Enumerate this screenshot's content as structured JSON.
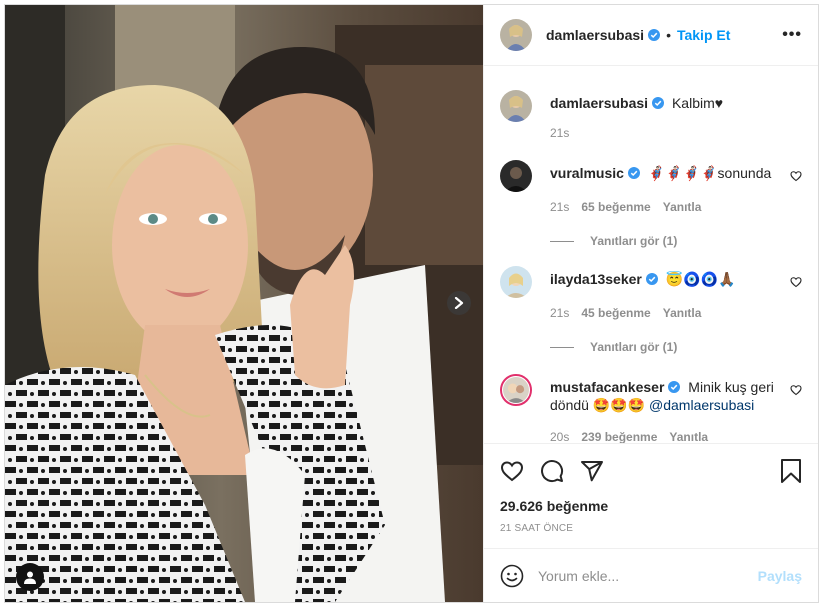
{
  "post": {
    "author": "damlaersubasi",
    "follow_label": "Takip Et",
    "dot": "•",
    "more": "•••"
  },
  "caption": {
    "username": "damlaersubasi",
    "text": "Kalbim♥",
    "time": "21s"
  },
  "comments": [
    {
      "username": "vuralmusic",
      "text": "🦸🏻‍♂️🦸🏻‍♂️🦸🏻‍♂️🦸🏻‍♂️sonunda",
      "time": "21s",
      "likes": "65 beğenme",
      "reply": "Yanıtla",
      "view_replies": "Yanıtları gör (1)"
    },
    {
      "username": "ilayda13seker",
      "text": "😇🧿🧿🙏🏾",
      "time": "21s",
      "likes": "45 beğenme",
      "reply": "Yanıtla",
      "view_replies": "Yanıtları gör (1)"
    },
    {
      "username": "mustafacankeser",
      "text": "Minik kuş geri döndü 🤩🤩🤩",
      "mention": "@damlaersubasi",
      "time": "20s",
      "likes": "239 beğenme",
      "reply": "Yanıtla"
    }
  ],
  "stats": {
    "likes": "29.626 beğenme",
    "posted": "21 SAAT ÖNCE"
  },
  "add_comment": {
    "placeholder": "Yorum ekle...",
    "share_label": "Paylaş"
  },
  "colors": {
    "accent": "#0095f6",
    "verified": "#3897f0",
    "muted": "#8e8e8e",
    "disabled_share": "#b2dffc"
  },
  "icons": [
    "heart-icon",
    "comment-icon",
    "share-icon",
    "bookmark-icon",
    "emoji-icon",
    "next-arrow-icon",
    "user-tag-icon",
    "verified-icon"
  ]
}
